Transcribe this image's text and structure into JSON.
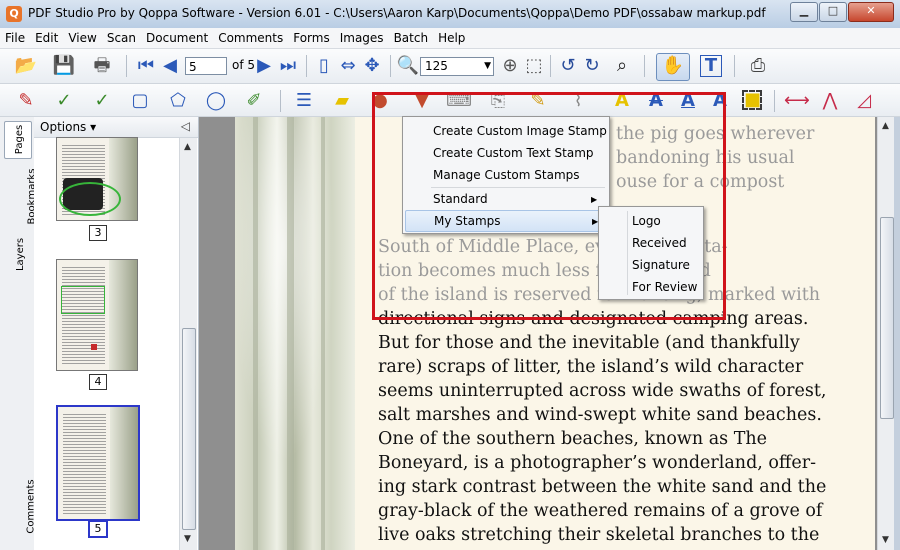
{
  "window": {
    "title": "PDF Studio Pro by Qoppa Software - Version 6.01 - C:\\Users\\Aaron Karp\\Documents\\Qoppa\\Demo PDF\\ossabaw markup.pdf"
  },
  "menubar": [
    "File",
    "Edit",
    "View",
    "Scan",
    "Document",
    "Comments",
    "Forms",
    "Images",
    "Batch",
    "Help"
  ],
  "navigation": {
    "page_value": "5",
    "page_of": "of 5",
    "zoom_value": "125"
  },
  "side_tabs": [
    "Pages",
    "Bookmarks",
    "Layers",
    "Comments"
  ],
  "thumb_panel": {
    "options_label": "Options",
    "pages": [
      "3",
      "4",
      "5"
    ],
    "selected_page": "5"
  },
  "context_menu": {
    "items": [
      "Create Custom Image Stamp",
      "Create Custom Text Stamp",
      "Manage Custom Stamps",
      "Standard",
      "My Stamps"
    ]
  },
  "submenu": {
    "items": [
      "Logo",
      "Received",
      "Signature",
      "For Review"
    ]
  },
  "document": {
    "lines": [
      "the pig goes wherever",
      "bandoning his usual",
      "ouse for a compost",
      "South of Middle Place, ev                   uman habita-",
      "tion becomes much less f                   e south end",
      "of the island is reserved for hunting, marked with",
      "directional signs and designated camping areas.",
      "But for those and the inevitable (and thankfully",
      "rare) scraps of litter, the island’s wild character",
      "seems uninterrupted across wide swaths of forest,",
      "salt marshes and wind-swept white sand beaches.",
      "One of the southern beaches, known as The",
      "Boneyard, is a photographer’s wonderland, offer-",
      "ing stark contrast between the white sand and the",
      "gray-black of the weathered remains of a grove of",
      "live oaks stretching their skeletal branches to the"
    ]
  },
  "colors": {
    "highlight_border": "#d0131b",
    "selected_thumb": "#2c37c9"
  }
}
